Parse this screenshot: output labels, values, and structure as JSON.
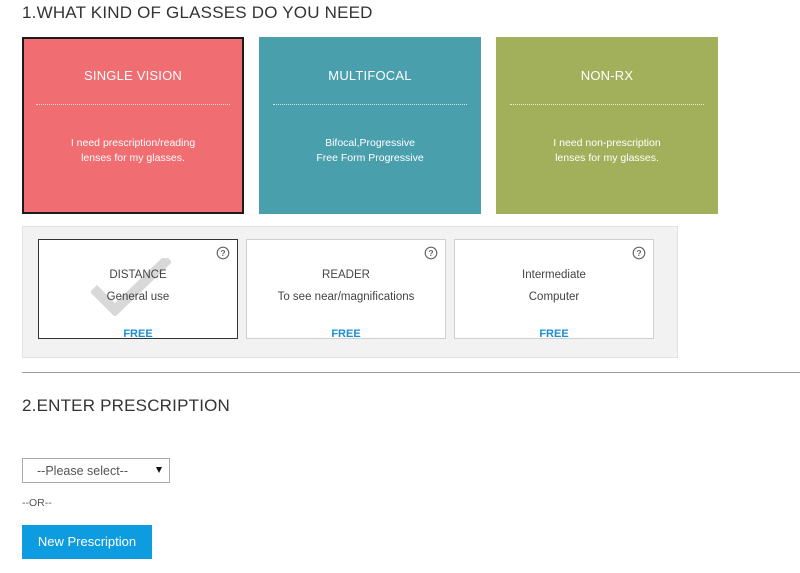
{
  "section1": {
    "title": "1.WHAT KIND OF GLASSES DO YOU NEED"
  },
  "lens_types": [
    {
      "title": "SINGLE VISION",
      "desc_line1": "I need prescription/reading",
      "desc_line2": "lenses for my glasses.",
      "color": "#f06d71",
      "selected": true
    },
    {
      "title": "MULTIFOCAL",
      "desc_line1": "Bifocal,Progressive",
      "desc_line2": "Free Form Progressive",
      "color": "#4a9fad",
      "selected": false
    },
    {
      "title": "NON-RX",
      "desc_line1": "I need non-prescription",
      "desc_line2": "lenses for my glasses.",
      "color": "#a2b05b",
      "selected": false
    }
  ],
  "usage_options": [
    {
      "name": "DISTANCE",
      "desc": "General use",
      "price": "FREE",
      "selected": true,
      "icon": "question-circle-icon"
    },
    {
      "name": "READER",
      "desc": "To see near/magnifications",
      "price": "FREE",
      "selected": false,
      "icon": "question-circle-icon"
    },
    {
      "name": "Intermediate",
      "desc": "Computer",
      "price": "FREE",
      "selected": false,
      "icon": "question-circle-icon"
    }
  ],
  "section2": {
    "title": "2.ENTER PRESCRIPTION",
    "select_value": "--Please select--",
    "or_label": "--OR--",
    "button_label": "New Prescription",
    "button_color": "#0e9ce0"
  }
}
